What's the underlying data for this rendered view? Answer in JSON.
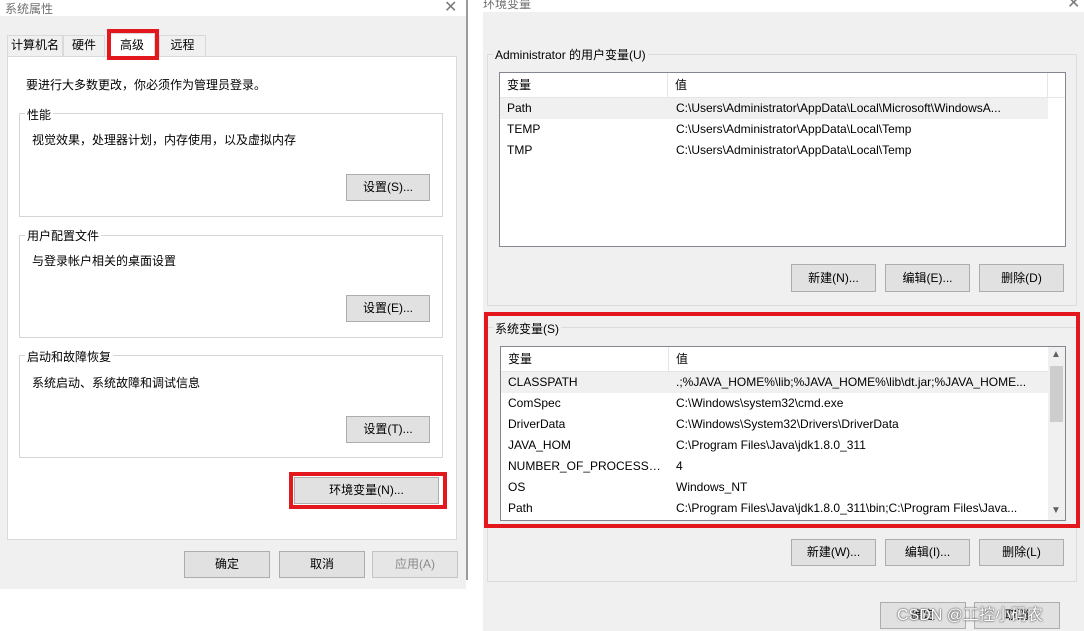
{
  "sysprops": {
    "title": "系统属性",
    "tabs": [
      "计算机名",
      "硬件",
      "高级",
      "远程"
    ],
    "notice": "要进行大多数更改，你必须作为管理员登录。",
    "performance": {
      "label": "性能",
      "desc": "视觉效果，处理器计划，内存使用，以及虚拟内存",
      "button": "设置(S)..."
    },
    "profile": {
      "label": "用户配置文件",
      "desc": "与登录帐户相关的桌面设置",
      "button": "设置(E)..."
    },
    "startup": {
      "label": "启动和故障恢复",
      "desc": "系统启动、系统故障和调试信息",
      "button": "设置(T)..."
    },
    "env_button": "环境变量(N)...",
    "ok": "确定",
    "cancel": "取消",
    "apply": "应用(A)"
  },
  "envvars": {
    "title": "环境变量",
    "user_group": "Administrator 的用户变量(U)",
    "col_var": "变量",
    "col_val": "值",
    "user_rows": [
      {
        "name": "Path",
        "value": "C:\\Users\\Administrator\\AppData\\Local\\Microsoft\\WindowsA..."
      },
      {
        "name": "TEMP",
        "value": "C:\\Users\\Administrator\\AppData\\Local\\Temp"
      },
      {
        "name": "TMP",
        "value": "C:\\Users\\Administrator\\AppData\\Local\\Temp"
      }
    ],
    "user_new": "新建(N)...",
    "user_edit": "编辑(E)...",
    "user_delete": "删除(D)",
    "sys_group": "系统变量(S)",
    "sys_rows": [
      {
        "name": "CLASSPATH",
        "value": ".;%JAVA_HOME%\\lib;%JAVA_HOME%\\lib\\dt.jar;%JAVA_HOME..."
      },
      {
        "name": "ComSpec",
        "value": "C:\\Windows\\system32\\cmd.exe"
      },
      {
        "name": "DriverData",
        "value": "C:\\Windows\\System32\\Drivers\\DriverData"
      },
      {
        "name": "JAVA_HOM",
        "value": "C:\\Program Files\\Java\\jdk1.8.0_311"
      },
      {
        "name": "NUMBER_OF_PROCESSORS",
        "value": "4"
      },
      {
        "name": "OS",
        "value": "Windows_NT"
      },
      {
        "name": "Path",
        "value": "C:\\Program Files\\Java\\jdk1.8.0_311\\bin;C:\\Program Files\\Java..."
      }
    ],
    "sys_new": "新建(W)...",
    "sys_edit": "编辑(I)...",
    "sys_delete": "删除(L)",
    "ok": "确定",
    "cancel": "取消"
  },
  "watermark": "CSDN @工控小码农",
  "accent_color": "#e3171e"
}
